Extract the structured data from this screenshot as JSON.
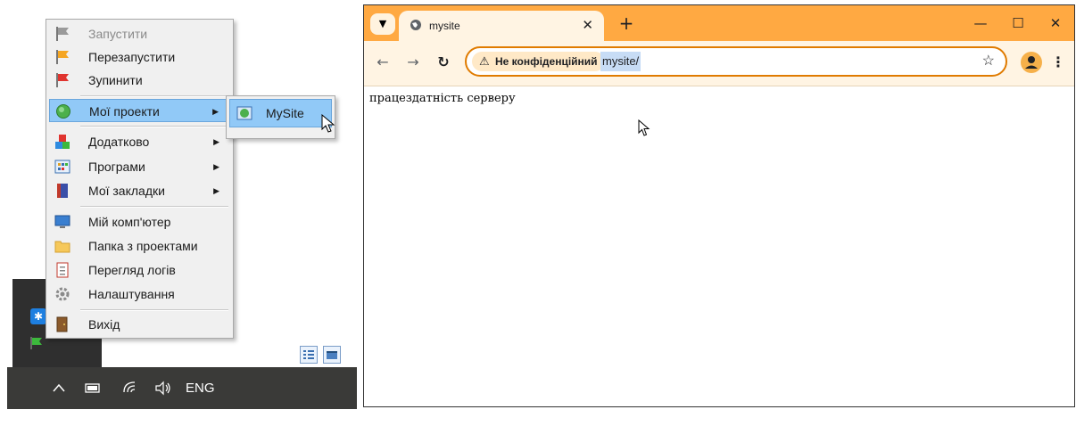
{
  "context_menu": {
    "items": [
      {
        "label": "Запустити",
        "icon": "flag-gray-icon",
        "disabled": true
      },
      {
        "label": "Перезапустити",
        "icon": "flag-orange-icon"
      },
      {
        "label": "Зупинити",
        "icon": "flag-red-icon"
      },
      {
        "label": "Мої проекти",
        "icon": "globe-icon",
        "submenu": true,
        "selected": true
      },
      {
        "label": "Додатково",
        "icon": "blocks-icon",
        "submenu": true
      },
      {
        "label": "Програми",
        "icon": "apps-grid-icon",
        "submenu": true
      },
      {
        "label": "Мої закладки",
        "icon": "book-icon",
        "submenu": true
      },
      {
        "label": "Мій комп'ютер",
        "icon": "computer-icon"
      },
      {
        "label": "Папка з проектами",
        "icon": "folder-icon"
      },
      {
        "label": "Перегляд логів",
        "icon": "log-icon"
      },
      {
        "label": "Налаштування",
        "icon": "gear-icon"
      },
      {
        "label": "Вихід",
        "icon": "exit-door-icon"
      }
    ]
  },
  "submenu": {
    "items": [
      {
        "label": "MySite",
        "icon": "site-globe-icon"
      }
    ]
  },
  "taskbar": {
    "language": "ENG"
  },
  "browser": {
    "tab_title": "mysite",
    "security_label": "Не конфіденційний",
    "url": "mysite/",
    "page_text": "працездатність серверу",
    "accent_color": "#ffa942"
  }
}
